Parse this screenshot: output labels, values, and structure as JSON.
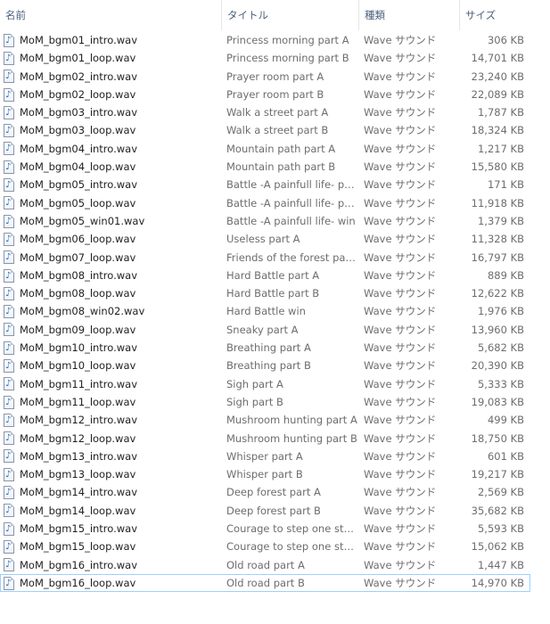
{
  "columns": {
    "name": "名前",
    "title": "タイトル",
    "type": "種類",
    "size": "サイズ"
  },
  "sort_indicator": "^",
  "icon": "audio-file-icon",
  "note_glyph": "♪",
  "files": [
    {
      "name": "MoM_bgm01_intro.wav",
      "title": "Princess morning part A",
      "type": "Wave サウンド",
      "size": "306 KB"
    },
    {
      "name": "MoM_bgm01_loop.wav",
      "title": "Princess morning part B",
      "type": "Wave サウンド",
      "size": "14,701 KB"
    },
    {
      "name": "MoM_bgm02_intro.wav",
      "title": "Prayer room part A",
      "type": "Wave サウンド",
      "size": "23,240 KB"
    },
    {
      "name": "MoM_bgm02_loop.wav",
      "title": "Prayer room part B",
      "type": "Wave サウンド",
      "size": "22,089 KB"
    },
    {
      "name": "MoM_bgm03_intro.wav",
      "title": "Walk a street part A",
      "type": "Wave サウンド",
      "size": "1,787 KB"
    },
    {
      "name": "MoM_bgm03_loop.wav",
      "title": "Walk a street part B",
      "type": "Wave サウンド",
      "size": "18,324 KB"
    },
    {
      "name": "MoM_bgm04_intro.wav",
      "title": "Mountain path part A",
      "type": "Wave サウンド",
      "size": "1,217 KB"
    },
    {
      "name": "MoM_bgm04_loop.wav",
      "title": "Mountain path part B",
      "type": "Wave サウンド",
      "size": "15,580 KB"
    },
    {
      "name": "MoM_bgm05_intro.wav",
      "title": "Battle -A painfull life- part...",
      "type": "Wave サウンド",
      "size": "171 KB"
    },
    {
      "name": "MoM_bgm05_loop.wav",
      "title": "Battle -A painfull life- part...",
      "type": "Wave サウンド",
      "size": "11,918 KB"
    },
    {
      "name": "MoM_bgm05_win01.wav",
      "title": "Battle -A painfull life- win",
      "type": "Wave サウンド",
      "size": "1,379 KB"
    },
    {
      "name": "MoM_bgm06_loop.wav",
      "title": "Useless part A",
      "type": "Wave サウンド",
      "size": "11,328 KB"
    },
    {
      "name": "MoM_bgm07_loop.wav",
      "title": "Friends of the forest part A",
      "type": "Wave サウンド",
      "size": "16,797 KB"
    },
    {
      "name": "MoM_bgm08_intro.wav",
      "title": "Hard Battle part A",
      "type": "Wave サウンド",
      "size": "889 KB"
    },
    {
      "name": "MoM_bgm08_loop.wav",
      "title": "Hard Battle part B",
      "type": "Wave サウンド",
      "size": "12,622 KB"
    },
    {
      "name": "MoM_bgm08_win02.wav",
      "title": "Hard Battle win",
      "type": "Wave サウンド",
      "size": "1,976 KB"
    },
    {
      "name": "MoM_bgm09_loop.wav",
      "title": "Sneaky part A",
      "type": "Wave サウンド",
      "size": "13,960 KB"
    },
    {
      "name": "MoM_bgm10_intro.wav",
      "title": "Breathing part A",
      "type": "Wave サウンド",
      "size": "5,682 KB"
    },
    {
      "name": "MoM_bgm10_loop.wav",
      "title": "Breathing part B",
      "type": "Wave サウンド",
      "size": "20,390 KB"
    },
    {
      "name": "MoM_bgm11_intro.wav",
      "title": "Sigh part A",
      "type": "Wave サウンド",
      "size": "5,333 KB"
    },
    {
      "name": "MoM_bgm11_loop.wav",
      "title": "Sigh part B",
      "type": "Wave サウンド",
      "size": "19,083 KB"
    },
    {
      "name": "MoM_bgm12_intro.wav",
      "title": "Mushroom hunting part A",
      "type": "Wave サウンド",
      "size": "499 KB"
    },
    {
      "name": "MoM_bgm12_loop.wav",
      "title": "Mushroom hunting part B",
      "type": "Wave サウンド",
      "size": "18,750 KB"
    },
    {
      "name": "MoM_bgm13_intro.wav",
      "title": "Whisper part A",
      "type": "Wave サウンド",
      "size": "601 KB"
    },
    {
      "name": "MoM_bgm13_loop.wav",
      "title": "Whisper part B",
      "type": "Wave サウンド",
      "size": "19,217 KB"
    },
    {
      "name": "MoM_bgm14_intro.wav",
      "title": "Deep forest part A",
      "type": "Wave サウンド",
      "size": "2,569 KB"
    },
    {
      "name": "MoM_bgm14_loop.wav",
      "title": "Deep forest part B",
      "type": "Wave サウンド",
      "size": "35,682 KB"
    },
    {
      "name": "MoM_bgm15_intro.wav",
      "title": "Courage to step one step ...",
      "type": "Wave サウンド",
      "size": "5,593 KB"
    },
    {
      "name": "MoM_bgm15_loop.wav",
      "title": "Courage to step one step ...",
      "type": "Wave サウンド",
      "size": "15,062 KB"
    },
    {
      "name": "MoM_bgm16_intro.wav",
      "title": "Old road part A",
      "type": "Wave サウンド",
      "size": "1,447 KB"
    },
    {
      "name": "MoM_bgm16_loop.wav",
      "title": "Old road part B",
      "type": "Wave サウンド",
      "size": "14,970 KB"
    }
  ],
  "focused_index": 30
}
